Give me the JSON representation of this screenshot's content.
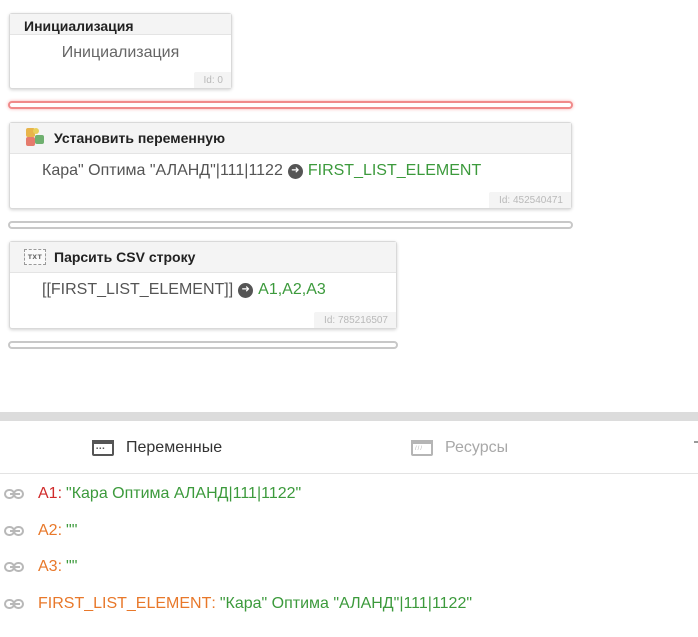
{
  "blocks": {
    "init": {
      "title": "Инициализация",
      "body": "Инициализация",
      "id": "Id: 0"
    },
    "set_var": {
      "title": "Установить переменную",
      "value": "Кара\" Оптима \"АЛАНД\"|111|1122",
      "target": "FIRST_LIST_ELEMENT",
      "id": "Id: 452540471"
    },
    "parse_csv": {
      "title": "Парсить CSV строку",
      "icon_text": "TXT",
      "value": "[[FIRST_LIST_ELEMENT]]",
      "target": "A1,A2,A3",
      "id": "Id: 785216507"
    }
  },
  "tabs": {
    "variables": "Переменные",
    "resources": "Ресурсы"
  },
  "variables": [
    {
      "name": "A1",
      "value": "\"Кара Оптима АЛАНД|111|1122\"",
      "color": "#d02b2b"
    },
    {
      "name": "A2",
      "value": "\"\"",
      "color": "#e8782a"
    },
    {
      "name": "A3",
      "value": "\"\"",
      "color": "#e8782a"
    },
    {
      "name": "FIRST_LIST_ELEMENT",
      "value": "\"Кара\" Оптима \"АЛАНД\"|111|1122\"",
      "color": "#e8782a"
    }
  ],
  "colors": {
    "value_green": "#3c9a3c",
    "error_red": "#d02b2b",
    "var_orange": "#e8782a",
    "connector_error": "#f08a8a"
  },
  "icons": {
    "set_var": "puzzle-icon",
    "parse_csv": "txt-file-icon",
    "arrow": "arrow-circle-right-icon",
    "variables_tab": "calculator-icon",
    "resources_tab": "resources-icon",
    "variable_row": "link-icon"
  }
}
